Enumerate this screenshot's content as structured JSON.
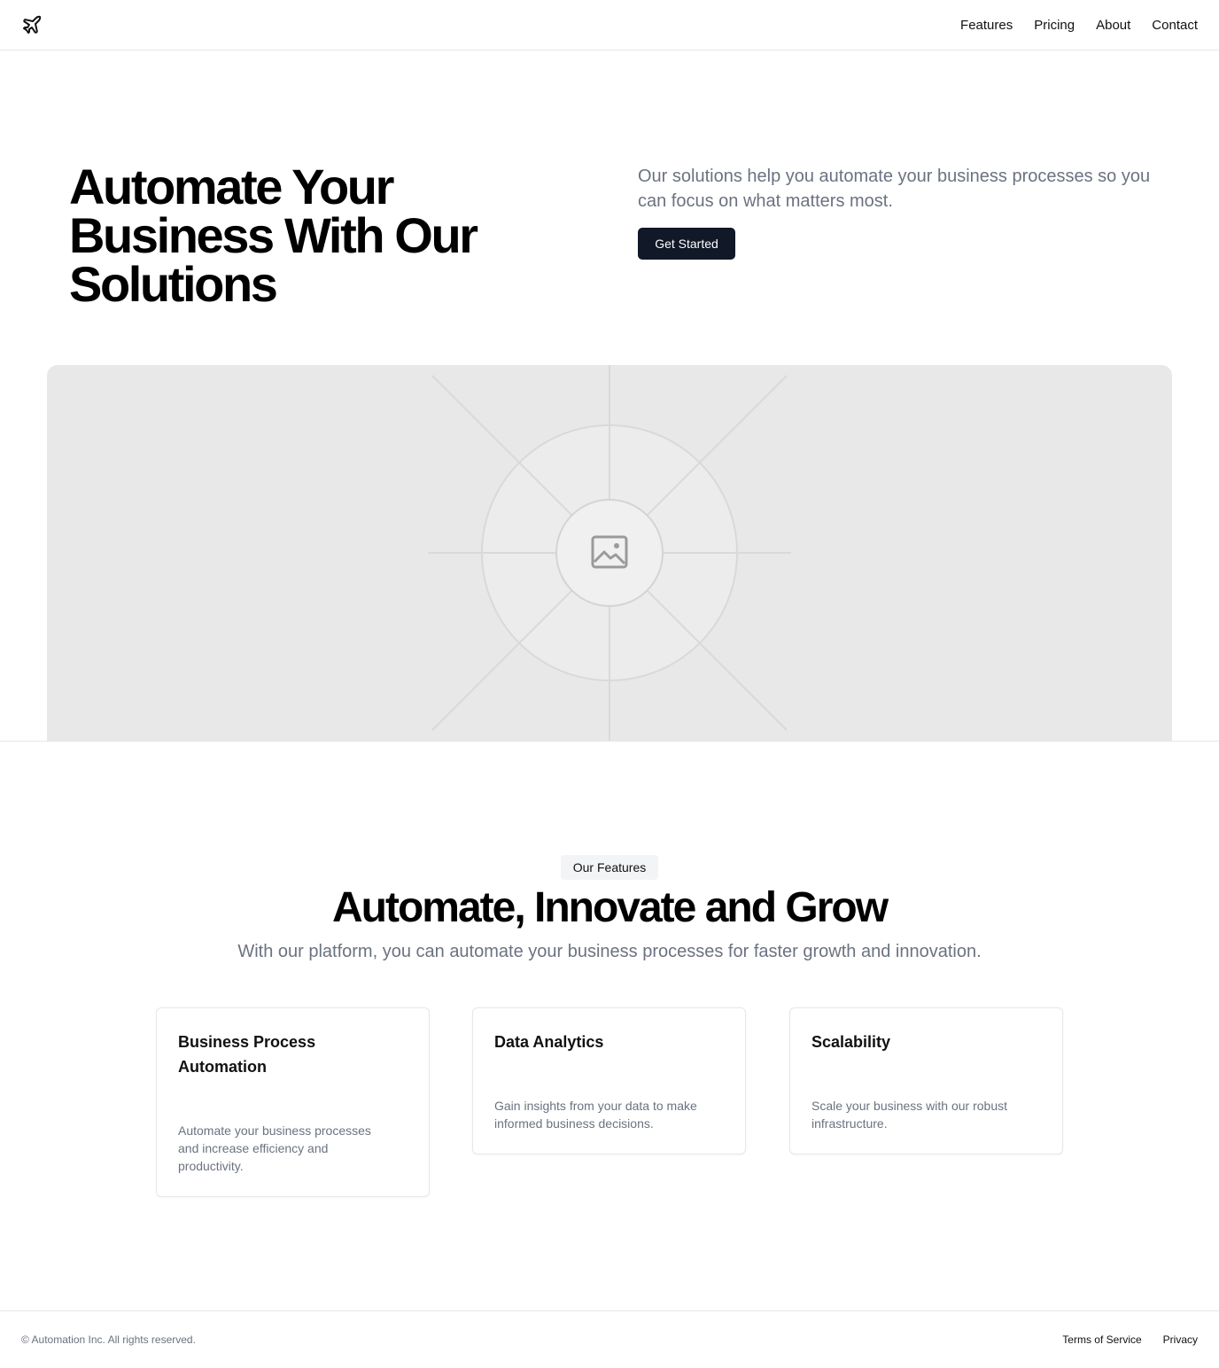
{
  "header": {
    "logo_icon": "plane-icon",
    "nav": [
      "Features",
      "Pricing",
      "About",
      "Contact"
    ]
  },
  "hero": {
    "title": "Automate Your Business With Our Solutions",
    "description": "Our solutions help you automate your business processes so you can focus on what matters most.",
    "cta_label": "Get Started",
    "image_icon": "image-placeholder-icon"
  },
  "features": {
    "badge": "Our Features",
    "title": "Automate, Innovate and Grow",
    "subtitle": "With our platform, you can automate your business processes for faster growth and innovation.",
    "cards": [
      {
        "title": "Business Process Automation",
        "description": "Automate your business processes and increase efficiency and productivity."
      },
      {
        "title": "Data Analytics",
        "description": "Gain insights from your data to make informed business decisions."
      },
      {
        "title": "Scalability",
        "description": "Scale your business with our robust infrastructure."
      }
    ]
  },
  "footer": {
    "copyright": "© Automation Inc. All rights reserved.",
    "links": [
      "Terms of Service",
      "Privacy"
    ]
  },
  "colors": {
    "primary_button": "#111827",
    "muted_text": "#6b7280",
    "border": "#e5e7eb",
    "placeholder_bg": "#e8e8e8"
  }
}
